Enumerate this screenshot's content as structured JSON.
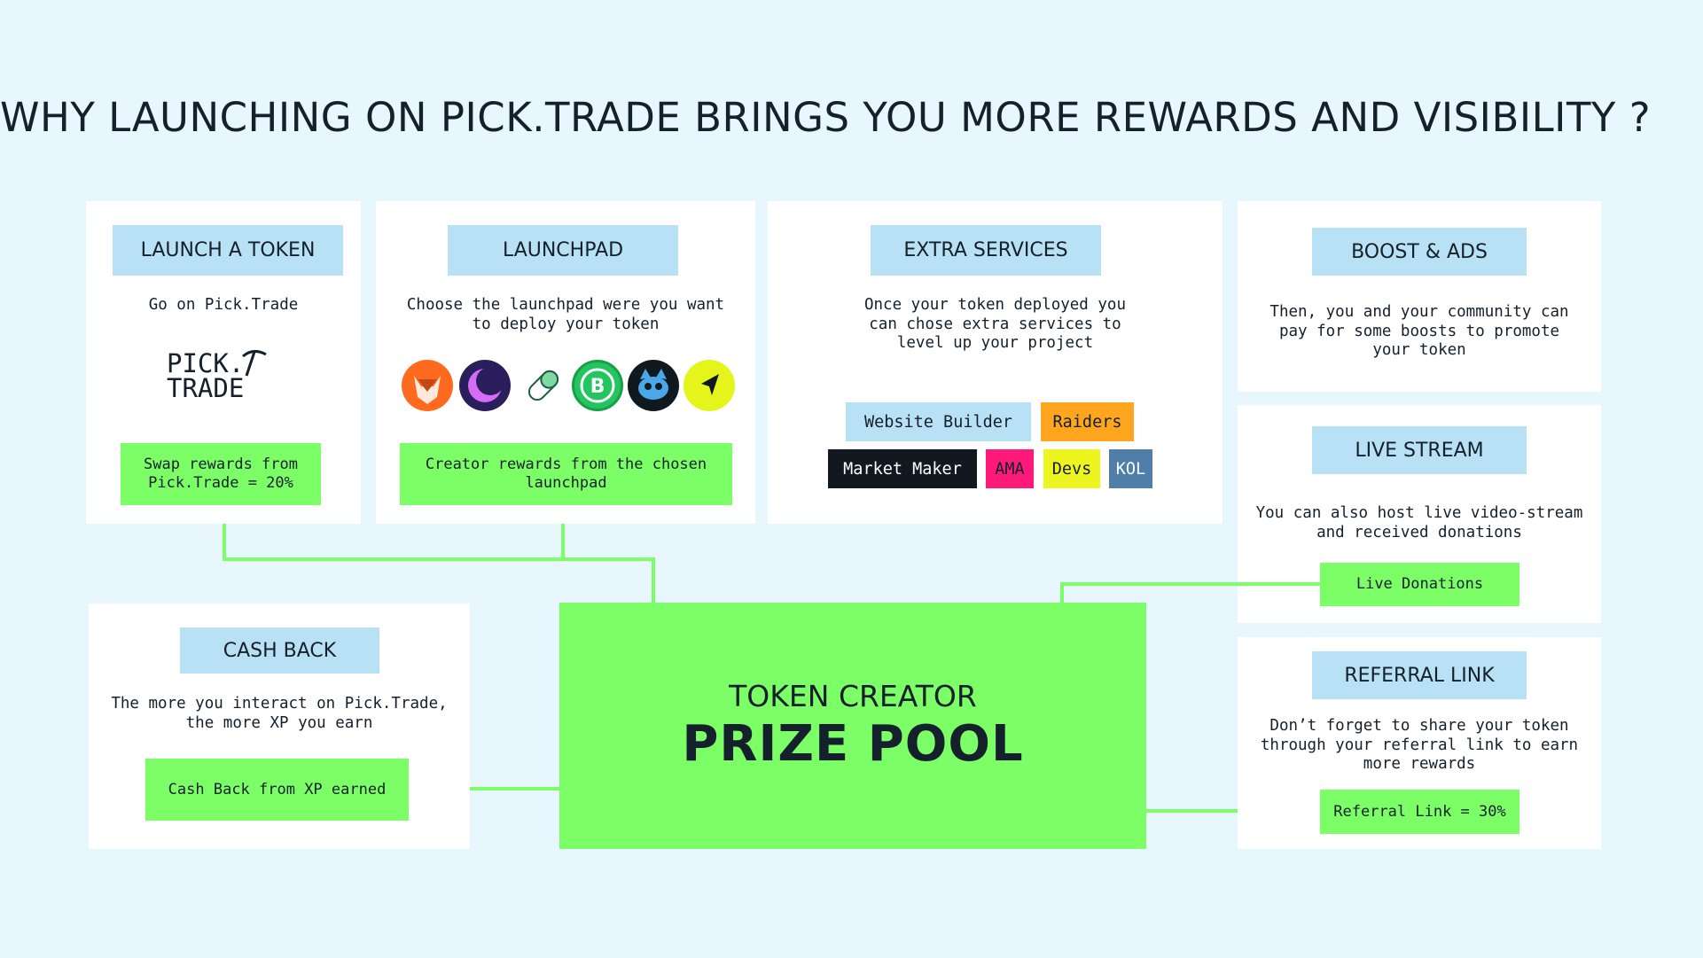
{
  "title": "WHY LAUNCHING ON PICK.TRADE BRINGS YOU MORE REWARDS AND VISIBILITY ?",
  "colors": {
    "background": "#e8f6fd",
    "card": "#ffffff",
    "header": "#b9e1f5",
    "accent_green": "#7cff66",
    "text": "#14202b"
  },
  "launch_token": {
    "header": "LAUNCH A TOKEN",
    "desc": "Go on Pick.Trade",
    "logo_text": "PICK.\nTRADE",
    "reward": "Swap rewards from\nPick.Trade = 20%"
  },
  "launchpad": {
    "header": "LAUNCHPAD",
    "desc": "Choose the launchpad were you want\nto deploy your token",
    "icons": [
      "fox-launchpad-icon",
      "moon-launchpad-icon",
      "pill-launchpad-icon",
      "b-launchpad-icon",
      "cat-launchpad-icon",
      "arrow-launchpad-icon"
    ],
    "reward": "Creator rewards from the chosen\nlaunchpad"
  },
  "extra_services": {
    "header": "EXTRA SERVICES",
    "desc": "Once your token deployed you\ncan chose extra services to\nlevel up your project",
    "tags": {
      "website_builder": "Website Builder",
      "raiders": "Raiders",
      "market_maker": "Market Maker",
      "ama": "AMA",
      "devs": "Devs",
      "kol": "KOL"
    }
  },
  "boost_ads": {
    "header": "BOOST & ADS",
    "desc": "Then, you and your community can\npay for some boosts to promote\nyour token"
  },
  "live_stream": {
    "header": "LIVE STREAM",
    "desc": "You can also host live video-stream\nand received donations",
    "reward": "Live Donations"
  },
  "cash_back": {
    "header": "CASH BACK",
    "desc": "The more you interact on Pick.Trade,\nthe more XP you earn",
    "reward": "Cash Back from XP earned"
  },
  "referral": {
    "header": "REFERRAL LINK",
    "desc": "Don’t forget to share your token\nthrough your referral link to earn\nmore rewards",
    "reward": "Referral Link = 30%"
  },
  "prize_pool": {
    "subtitle": "TOKEN CREATOR",
    "title": "PRIZE POOL"
  }
}
